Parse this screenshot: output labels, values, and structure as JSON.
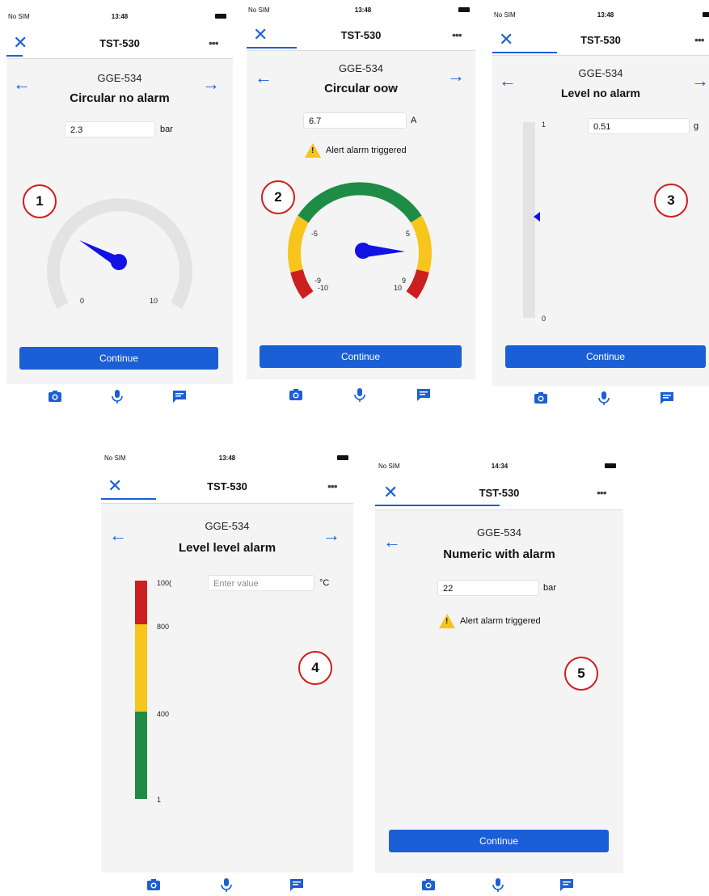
{
  "colors": {
    "accent": "#1b5fd6",
    "gauge_green": "#1e8c45",
    "gauge_yellow": "#f7c51b",
    "gauge_red": "#cc1f1f",
    "gauge_grey": "#e3e3e3",
    "callout_red": "#d21d1d"
  },
  "icons": {
    "close": "close-icon",
    "more": "more-icon",
    "back": "arrow-left-icon",
    "forward": "arrow-right-icon",
    "camera": "camera-icon",
    "mic": "microphone-icon",
    "comment": "comment-icon",
    "warning": "warning-icon"
  },
  "screens": [
    {
      "status": {
        "carrier": "No SIM",
        "time": "13:48"
      },
      "title": "TST-530",
      "code": "GGE-534",
      "heading": "Circular no alarm",
      "input_value": "2.3",
      "unit": "bar",
      "gauge": {
        "min_label": "0",
        "max_label": "10",
        "value": 2.3
      },
      "button": "Continue",
      "callout": "1"
    },
    {
      "status": {
        "carrier": "No SIM",
        "time": "13:48"
      },
      "title": "TST-530",
      "code": "GGE-534",
      "heading": "Circular oow",
      "input_value": "6.7",
      "unit": "A",
      "alert": "Alert alarm triggered",
      "gauge": {
        "labels": [
          "-5",
          "5",
          "-9",
          "-10",
          "9",
          "10"
        ],
        "value": 6.7
      },
      "button": "Continue",
      "callout": "2"
    },
    {
      "status": {
        "carrier": "No SIM",
        "time": "13:48"
      },
      "title": "TST-530",
      "code": "GGE-534",
      "heading": "Level no alarm",
      "input_value": "0.51",
      "unit": "g",
      "level": {
        "top_label": "1",
        "bottom_label": "0",
        "value": 0.51
      },
      "button": "Continue",
      "callout": "3"
    },
    {
      "status": {
        "carrier": "No SIM",
        "time": "13:48"
      },
      "title": "TST-530",
      "code": "GGE-534",
      "heading": "Level level alarm",
      "input_placeholder": "Enter value",
      "unit": "°C",
      "level": {
        "labels": [
          "100(",
          "800",
          "400",
          "1"
        ]
      },
      "callout": "4"
    },
    {
      "status": {
        "carrier": "No SIM",
        "time": "14:34"
      },
      "title": "TST-530",
      "code": "GGE-534",
      "heading": "Numeric with alarm",
      "input_value": "22",
      "unit": "bar",
      "alert": "Alert alarm triggered",
      "button": "Continue",
      "callout": "5"
    }
  ]
}
